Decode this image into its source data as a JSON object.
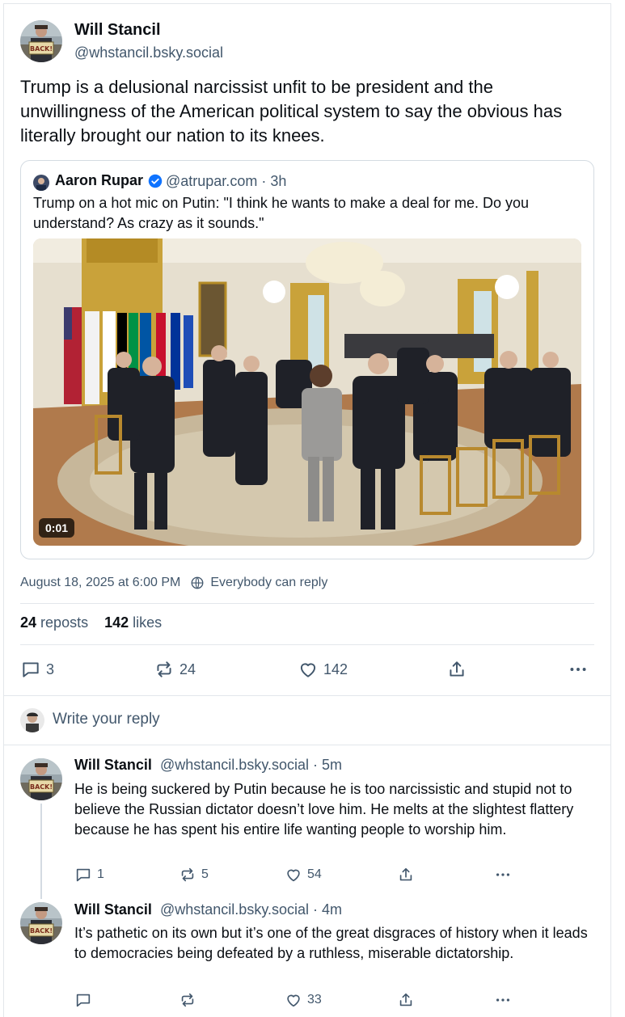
{
  "post": {
    "author_name": "Will Stancil",
    "author_handle": "@whstancil.bsky.social",
    "avatar_sign_text": "BACK!",
    "text": "Trump is a delusional narcissist unfit to be president and the unwillingness of the American political system to say the obvious has literally brought our nation to its knees.",
    "quote": {
      "author_name": "Aaron Rupar",
      "author_handle": "@atrupar.com · 3h",
      "text": "Trump on a hot mic on Putin: \"I think he wants to make a deal for me. Do you understand? As crazy as it sounds.\"",
      "video_time": "0:01"
    },
    "timestamp": "August 18, 2025 at 6:00 PM",
    "reply_setting": "Everybody can reply",
    "reposts_count": "24",
    "reposts_label": "reposts",
    "likes_count": "142",
    "likes_label": "likes",
    "actions": {
      "replies": "3",
      "reposts": "24",
      "likes": "142"
    }
  },
  "reply_box": {
    "placeholder": "Write your reply"
  },
  "replies": [
    {
      "author_name": "Will Stancil",
      "author_handle": "@whstancil.bsky.social · 5m",
      "text": "He is being suckered by Putin because he is too narcissistic and stupid not to believe the Russian dictator doesn’t love him. He melts at the slightest flattery because he has spent his entire life wanting people to worship him.",
      "replies": "1",
      "reposts": "5",
      "likes": "54"
    },
    {
      "author_name": "Will Stancil",
      "author_handle": "@whstancil.bsky.social · 4m",
      "text": "It’s pathetic on its own but it’s one of the great disgraces of history when it leads to democracies being defeated by a ruthless, miserable dictatorship.",
      "replies": "",
      "reposts": "",
      "likes": "33"
    }
  ],
  "colors": {
    "text": "#0b0f14",
    "muted": "#42576c",
    "border": "#e3e7eb",
    "verified": "#0f73ff"
  }
}
